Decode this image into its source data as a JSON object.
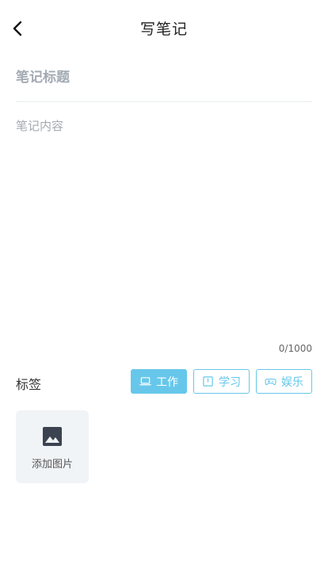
{
  "header": {
    "title": "写笔记",
    "back_icon": "chevron-left-icon"
  },
  "note": {
    "title_placeholder": "笔记标题",
    "title_value": "",
    "content_placeholder": "笔记内容",
    "content_value": "",
    "counter": "0/1000"
  },
  "tags": {
    "label": "标签",
    "items": [
      {
        "label": "工作",
        "icon": "laptop-icon",
        "selected": true
      },
      {
        "label": "学习",
        "icon": "book-icon",
        "selected": false
      },
      {
        "label": "娱乐",
        "icon": "gamepad-icon",
        "selected": false
      }
    ],
    "accent_color": "#67c7ea"
  },
  "add_image": {
    "label": "添加图片",
    "icon": "image-icon"
  }
}
